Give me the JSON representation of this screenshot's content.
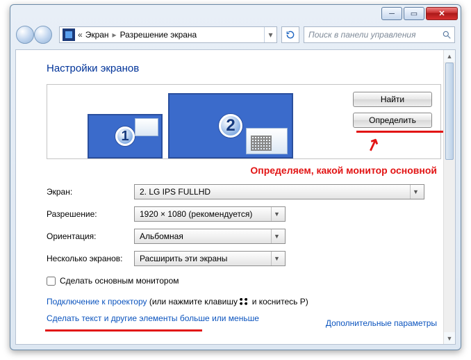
{
  "breadcrumb": {
    "level1": "Экран",
    "level2": "Разрешение экрана",
    "back_chevron": "«"
  },
  "search": {
    "placeholder": "Поиск в панели управления"
  },
  "heading": "Настройки экранов",
  "monitor_labels": {
    "m1": "1",
    "m2": "2"
  },
  "buttons": {
    "find": "Найти",
    "identify": "Определить"
  },
  "annotation": "Определяем, какой монитор основной",
  "form": {
    "screen_label": "Экран:",
    "screen_value": "2. LG IPS FULLHD",
    "res_label": "Разрешение:",
    "res_value": "1920 × 1080 (рекомендуется)",
    "orient_label": "Ориентация:",
    "orient_value": "Альбомная",
    "multi_label": "Несколько экранов:",
    "multi_value": "Расширить эти экраны"
  },
  "checkbox_label": "Сделать основным монитором",
  "advanced_link": "Дополнительные параметры",
  "projector_line": {
    "link": "Подключение к проектору",
    "suffix1": " (или нажмите клавишу ",
    "suffix2": " и коснитесь P)"
  },
  "textsize_link": "Сделать текст и другие элементы больше или меньше"
}
